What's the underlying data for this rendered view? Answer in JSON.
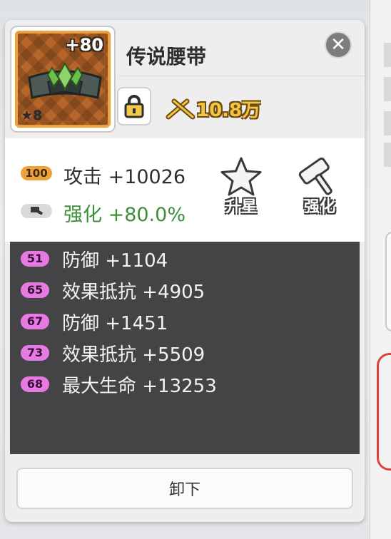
{
  "item": {
    "name": "传说腰带",
    "level": "+80",
    "stars": "★8",
    "power": "10.8万",
    "icon": "legend-belt-icon"
  },
  "main_stat": {
    "badge": "100",
    "text": "攻击 +10026"
  },
  "enhance_stat": {
    "text": "强化 +80.0%",
    "icon": "hammer-icon"
  },
  "actions": {
    "star_up_label": "升星",
    "enhance_label": "强化"
  },
  "substats": [
    {
      "badge": "51",
      "text": "防御 +1104"
    },
    {
      "badge": "65",
      "text": "效果抵抗 +4905"
    },
    {
      "badge": "67",
      "text": "防御 +1451"
    },
    {
      "badge": "73",
      "text": "效果抵抗 +5509"
    },
    {
      "badge": "68",
      "text": "最大生命 +13253"
    }
  ],
  "unequip_label": "卸下",
  "colors": {
    "rarity_border": "#f0a23a",
    "enhance_green": "#3e8f3a",
    "substat_badge": "#e57ae0",
    "power_gold": "#f5c542"
  }
}
